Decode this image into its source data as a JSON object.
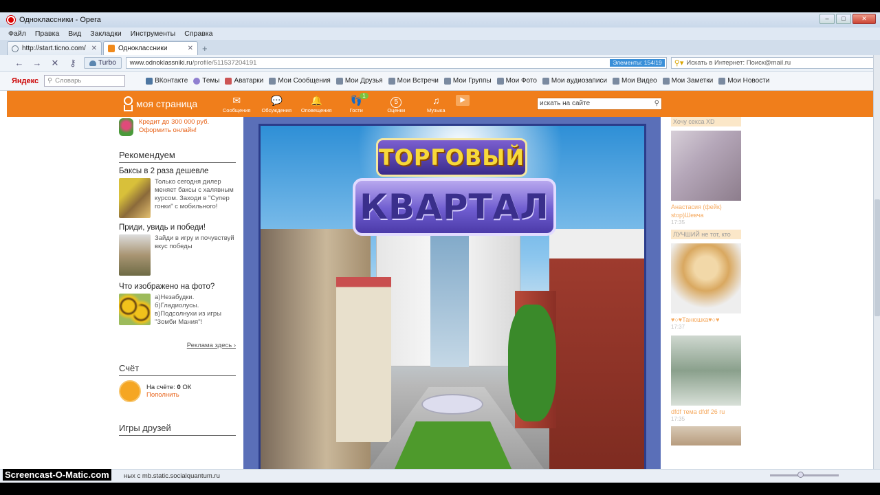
{
  "window": {
    "title": "Одноклассники - Opera"
  },
  "menu": [
    "Файл",
    "Правка",
    "Вид",
    "Закладки",
    "Инструменты",
    "Справка"
  ],
  "tabs": [
    {
      "label": "http://start.ticno.com/",
      "active": false
    },
    {
      "label": "Одноклассники",
      "active": true
    }
  ],
  "address": {
    "turbo": "Turbo",
    "url_host": "www.odnoklassniki.ru",
    "url_path": "/profile/511537204191",
    "elements_badge": "Элементы: 154/19",
    "search": "Искать в Интернет: Поиск@mail.ru"
  },
  "bookmarks": {
    "yandex_logo": "Яндекс",
    "dict_placeholder": "Словарь",
    "items": [
      "ВКонтакте",
      "Темы",
      "Аватарки",
      "Мои Сообщения",
      "Мои Друзья",
      "Мои Встречи",
      "Мои Группы",
      "Мои Фото",
      "Мои аудиозаписи",
      "Мои Видео",
      "Мои Заметки",
      "Мои Новости"
    ]
  },
  "ok": {
    "brand": "моя страница",
    "nav": [
      {
        "label": "Сообщения",
        "icon": "envelope-icon"
      },
      {
        "label": "Обсуждения",
        "icon": "chat-icon"
      },
      {
        "label": "Оповещения",
        "icon": "bell-icon"
      },
      {
        "label": "Гости",
        "icon": "footprints-icon",
        "badge": "1"
      },
      {
        "label": "Оценки",
        "icon": "rating-icon",
        "count": "5"
      },
      {
        "label": "Музыка",
        "icon": "music-icon"
      }
    ],
    "search_placeholder": "искать на сайте"
  },
  "left": {
    "credit": "Кредит до 300 000 руб. Оформить онлайн!",
    "recommend_title": "Рекомендуем",
    "ads": [
      {
        "title": "Баксы в 2 раза дешевле",
        "text": "Только сегодня дилер меняет баксы с халявным курсом. Заходи в \"Супер гонки\" с мобильного!"
      },
      {
        "title": "Приди, увидь и победи!",
        "text": "Зайди в игру и почувствуй вкус победы"
      },
      {
        "title": "Что изображено на фото?",
        "text": "а)Незабудки. б)Гладиолусы. в)Подсолнухи из игры \"Зомби Мания\"!"
      }
    ],
    "ad_link": "Реклама здесь ›",
    "account_title": "Счёт",
    "account_text": "На счёте:",
    "account_value": "0",
    "account_unit": "ОК",
    "account_topup": "Пополнить",
    "friends_games": "Игры друзей"
  },
  "game": {
    "line1": "ТОРГОВЫЙ",
    "line2": "КВАРТАЛ"
  },
  "guests": [
    {
      "caption": "Хочу секса XD",
      "name": "Анастасия (фейк) stop)Шевча",
      "time": "17:35"
    },
    {
      "caption": "ЛУЧШИЙ не тот, кто",
      "name": "♥○♥Танюшка♥○♥",
      "time": "17:37"
    },
    {
      "caption": "",
      "name": "dfdf тема dfdf 26 ru",
      "time": "17:35"
    },
    {
      "caption": "",
      "name": "",
      "time": ""
    }
  ],
  "status": {
    "text": "ных с mb.static.socialquantum.ru"
  },
  "watermark": "Screencast-O-Matic.com"
}
